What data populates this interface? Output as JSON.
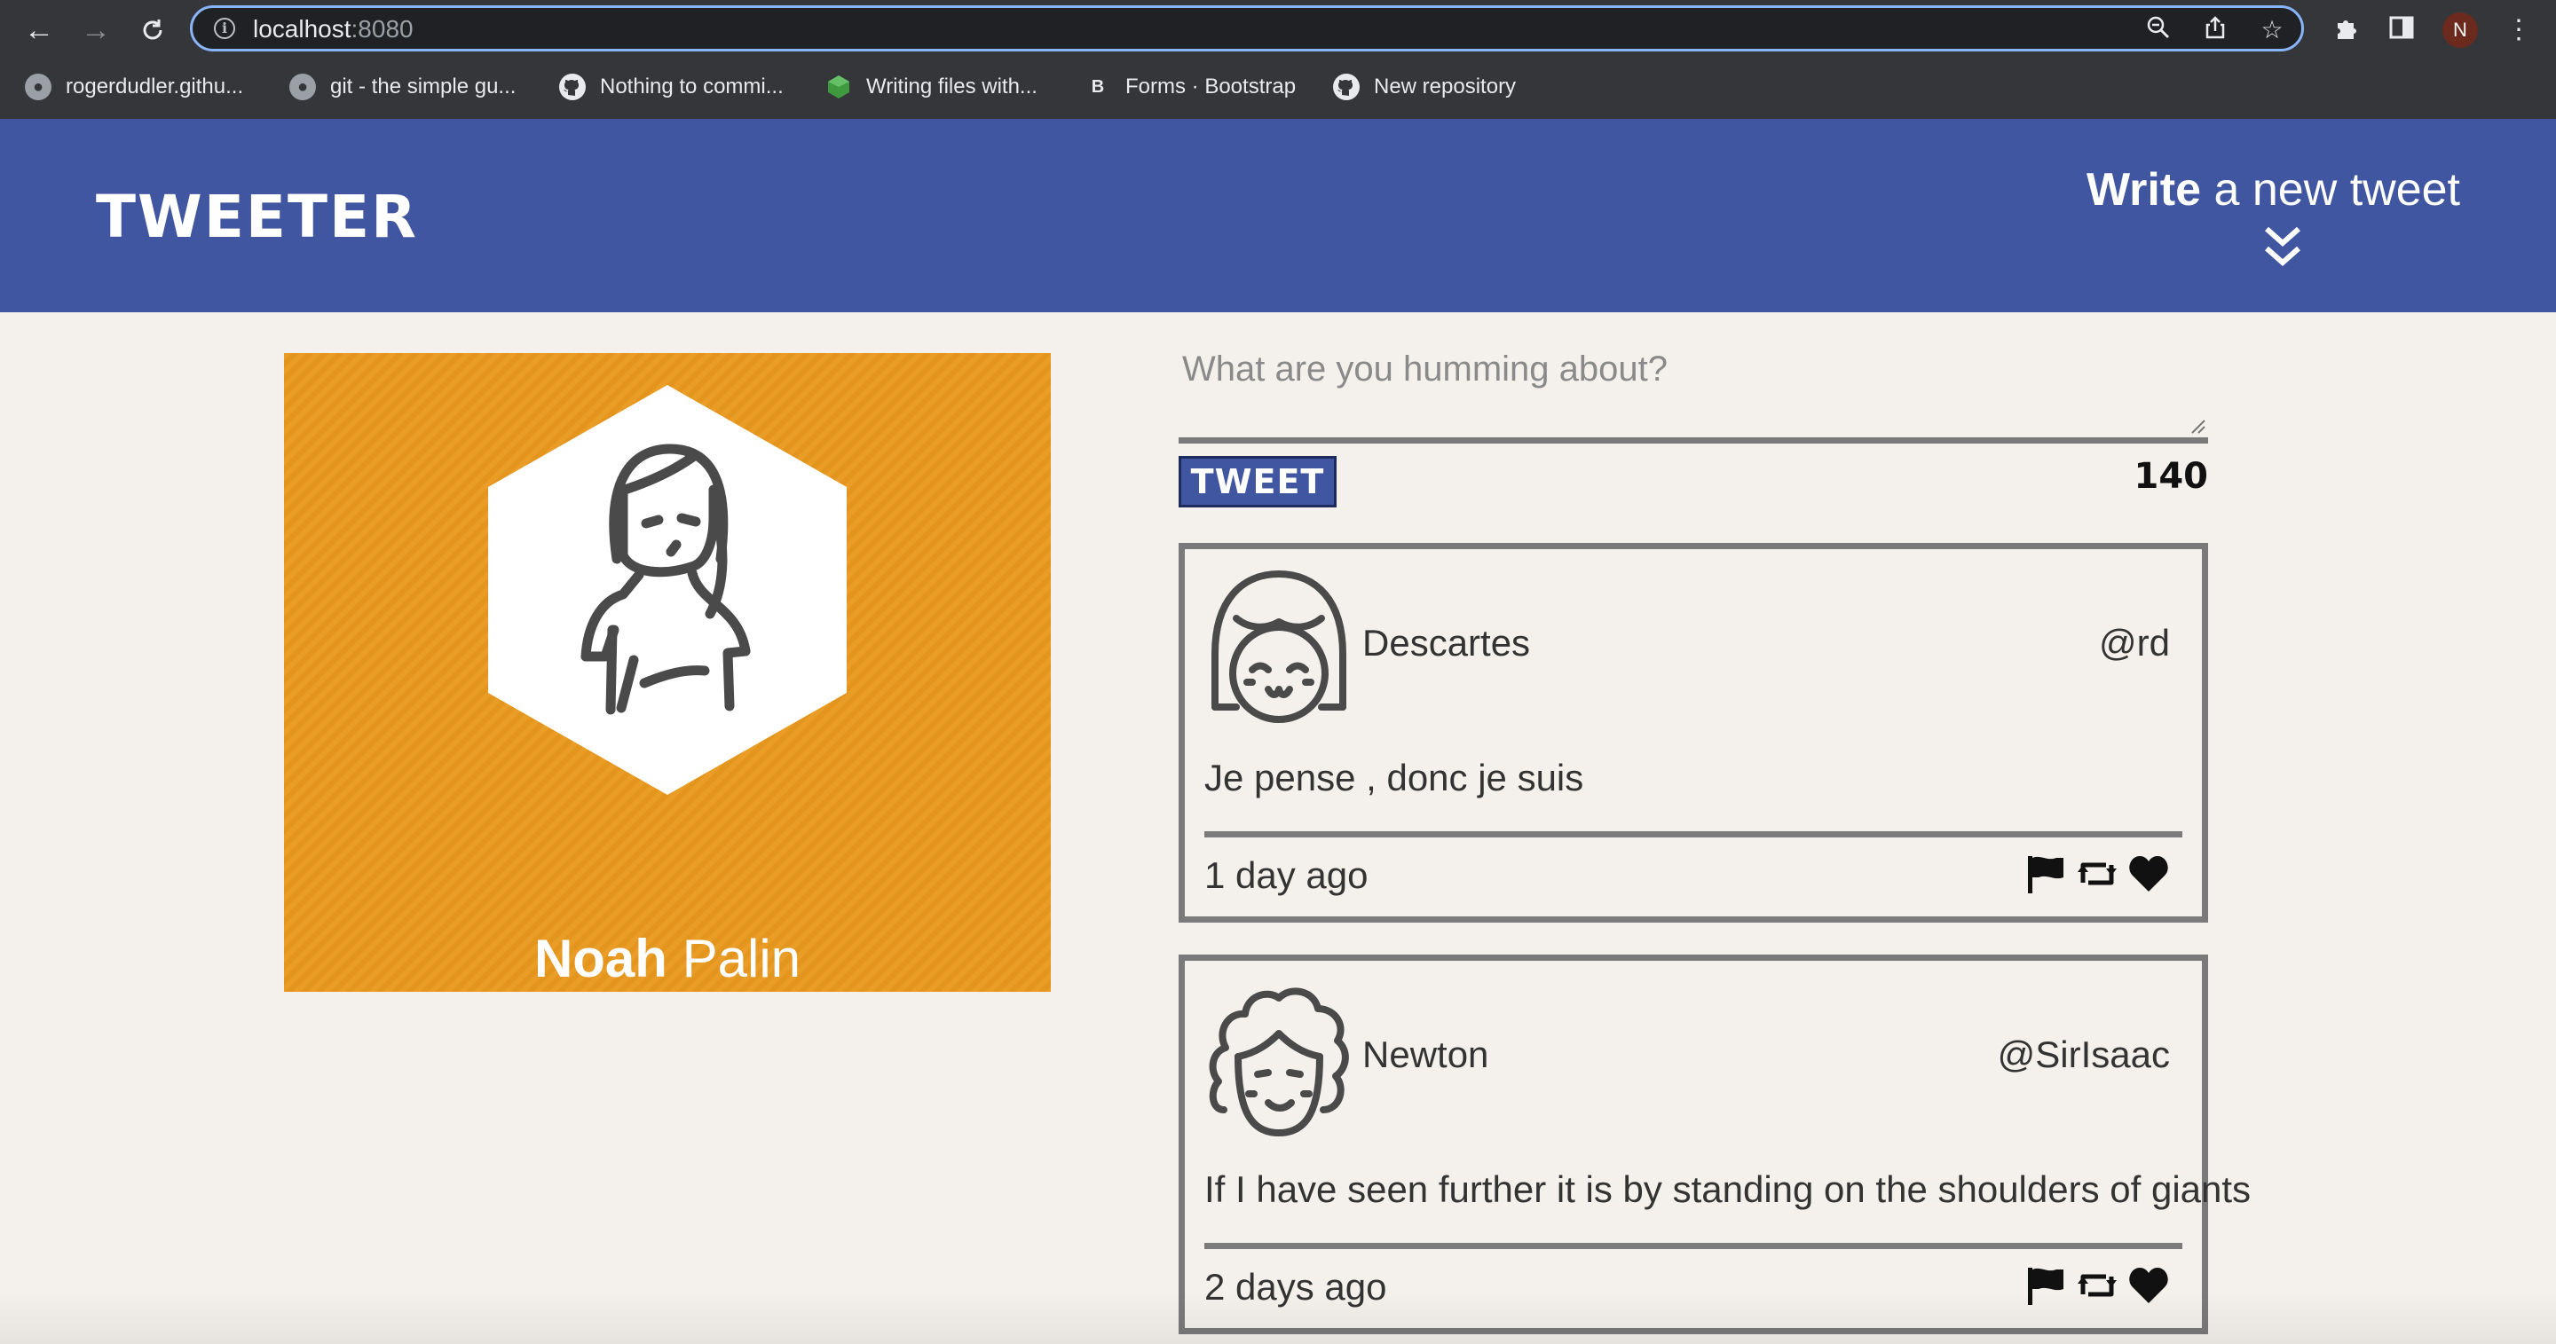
{
  "browser": {
    "url_host": "localhost",
    "url_port": ":8080",
    "profile_initial": "N",
    "bookmarks": [
      {
        "label": "rogerdudler.githu...",
        "icon": "globe-icon"
      },
      {
        "label": "git - the simple gu...",
        "icon": "globe-icon"
      },
      {
        "label": "Nothing to commi...",
        "icon": "github-icon"
      },
      {
        "label": "Writing files with...",
        "icon": "nodejs-icon"
      },
      {
        "label": "Forms · Bootstrap",
        "icon": "bootstrap-icon"
      },
      {
        "label": "New repository",
        "icon": "github-icon"
      }
    ]
  },
  "header": {
    "logo": "TWEETER",
    "compose_bold": "Write",
    "compose_rest": " a new tweet"
  },
  "profile": {
    "first_name": "Noah",
    "last_name": " Palin",
    "card_color": "#e8981e"
  },
  "compose": {
    "placeholder": "What are you humming about?",
    "button_label": "TWEET",
    "counter": "140"
  },
  "tweets": [
    {
      "name": "Descartes",
      "handle": "@rd",
      "content": "Je pense , donc je suis",
      "time": "1 day ago"
    },
    {
      "name": "Newton",
      "handle": "@SirIsaac",
      "content": "If I have seen further it is by standing on the shoulders of giants",
      "time": "2 days ago"
    }
  ],
  "colors": {
    "header_bg": "#4056a1",
    "page_bg": "#f4f1ec",
    "border": "#7a7a7a"
  }
}
